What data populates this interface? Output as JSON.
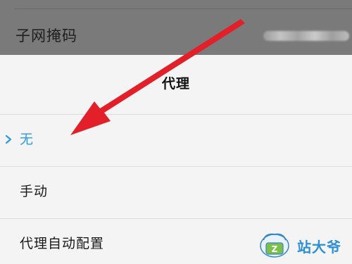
{
  "background": {
    "subnet_mask_label": "子网掩码"
  },
  "dialog": {
    "title": "代理",
    "options": [
      {
        "label": "无",
        "selected": true
      },
      {
        "label": "手动",
        "selected": false
      },
      {
        "label": "代理自动配置",
        "selected": false
      }
    ]
  },
  "watermark": {
    "text": "站大爷"
  },
  "colors": {
    "accent": "#2d9be3",
    "arrow": "#e3202a",
    "overlay": "#7a7a7a"
  }
}
